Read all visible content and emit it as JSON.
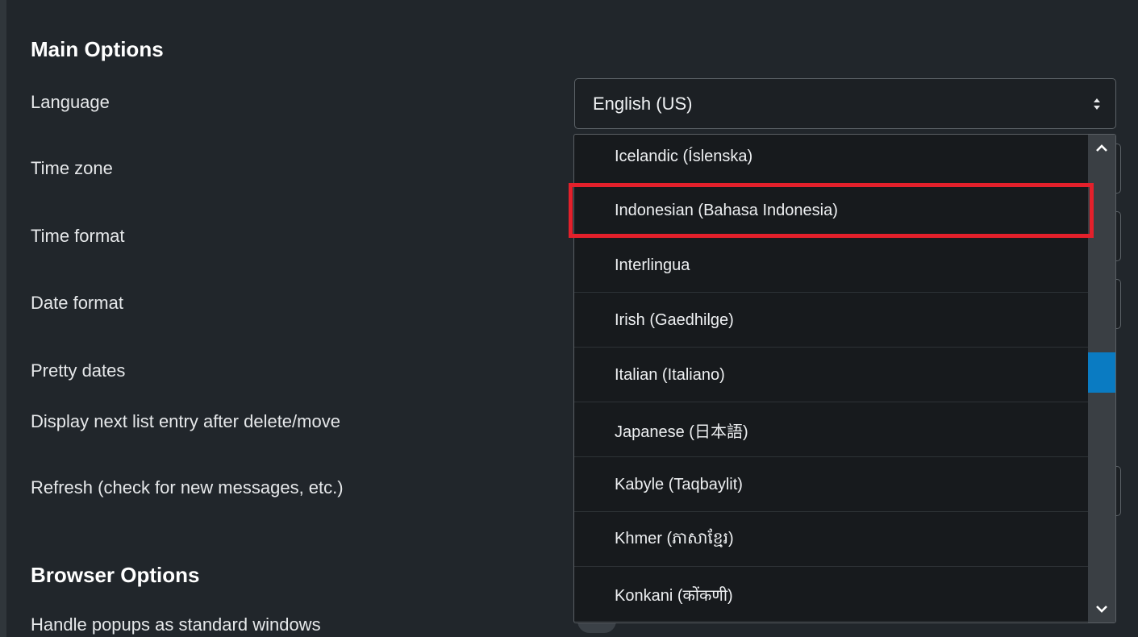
{
  "main_options": {
    "title": "Main Options",
    "labels": {
      "language": "Language",
      "time_zone": "Time zone",
      "time_format": "Time format",
      "date_format": "Date format",
      "pretty_dates": "Pretty dates",
      "display_next": "Display next list entry after delete/move",
      "refresh": "Refresh (check for new messages, etc.)"
    }
  },
  "browser_options": {
    "title": "Browser Options",
    "labels": {
      "handle_popups": "Handle popups as standard windows"
    }
  },
  "language_select": {
    "value": "English (US)",
    "options": [
      "Icelandic (Íslenska)",
      "Indonesian (Bahasa Indonesia)",
      "Interlingua",
      "Irish (Gaedhilge)",
      "Italian (Italiano)",
      "Japanese (日本語)",
      "Kabyle (Taqbaylit)",
      "Khmer (ភាសាខ្មែរ)",
      "Konkani (कोंकणी)"
    ],
    "highlighted_option": "Indonesian (Bahasa Indonesia)"
  },
  "colors": {
    "highlight": "#e3202b",
    "scroll_thumb": "#0a7bc2",
    "background": "#21262b"
  },
  "icons": {
    "select_caret": "sort-caret-icon",
    "scroll_up": "chevron-up-icon",
    "scroll_down": "chevron-down-icon"
  }
}
